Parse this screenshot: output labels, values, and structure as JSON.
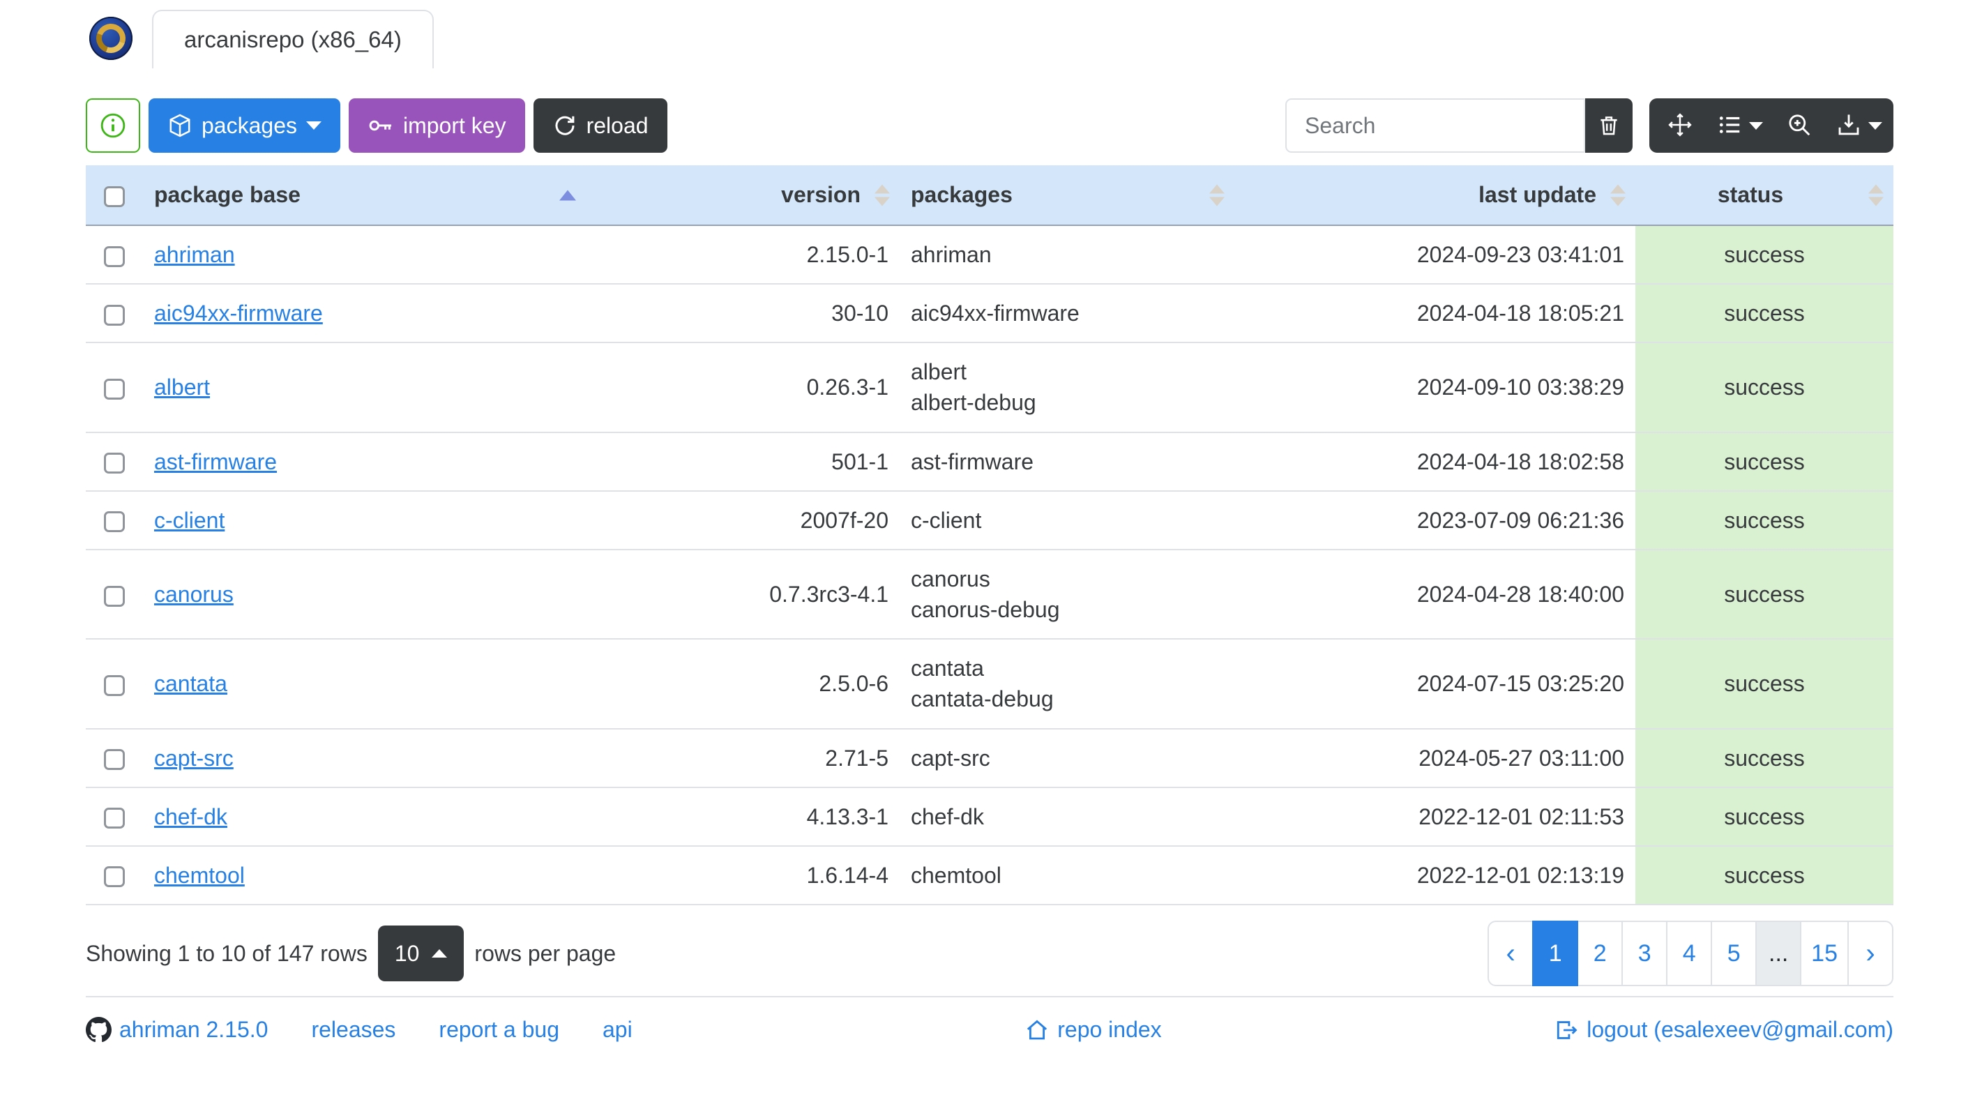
{
  "window": {
    "tab_title": "arcanisrepo (x86_64)"
  },
  "toolbar": {
    "info_button": "i",
    "packages_label": "packages",
    "import_key_label": "import key",
    "reload_label": "reload",
    "search_placeholder": "Search",
    "icon_buttons": [
      "trash-icon",
      "arrows-move-icon",
      "columns-list-icon",
      "zoom-in-icon",
      "export-download-icon"
    ]
  },
  "table": {
    "columns": {
      "package_base": "package base",
      "version": "version",
      "packages": "packages",
      "last_update": "last update",
      "status": "status"
    },
    "sort": {
      "column": "package base",
      "direction": "asc"
    },
    "rows": [
      {
        "package_base": "ahriman",
        "version": "2.15.0-1",
        "packages": [
          "ahriman"
        ],
        "last_update": "2024-09-23 03:41:01",
        "status": "success"
      },
      {
        "package_base": "aic94xx-firmware",
        "version": "30-10",
        "packages": [
          "aic94xx-firmware"
        ],
        "last_update": "2024-04-18 18:05:21",
        "status": "success"
      },
      {
        "package_base": "albert",
        "version": "0.26.3-1",
        "packages": [
          "albert",
          "albert-debug"
        ],
        "last_update": "2024-09-10 03:38:29",
        "status": "success"
      },
      {
        "package_base": "ast-firmware",
        "version": "501-1",
        "packages": [
          "ast-firmware"
        ],
        "last_update": "2024-04-18 18:02:58",
        "status": "success"
      },
      {
        "package_base": "c-client",
        "version": "2007f-20",
        "packages": [
          "c-client"
        ],
        "last_update": "2023-07-09 06:21:36",
        "status": "success"
      },
      {
        "package_base": "canorus",
        "version": "0.7.3rc3-4.1",
        "packages": [
          "canorus",
          "canorus-debug"
        ],
        "last_update": "2024-04-28 18:40:00",
        "status": "success"
      },
      {
        "package_base": "cantata",
        "version": "2.5.0-6",
        "packages": [
          "cantata",
          "cantata-debug"
        ],
        "last_update": "2024-07-15 03:25:20",
        "status": "success"
      },
      {
        "package_base": "capt-src",
        "version": "2.71-5",
        "packages": [
          "capt-src"
        ],
        "last_update": "2024-05-27 03:11:00",
        "status": "success"
      },
      {
        "package_base": "chef-dk",
        "version": "4.13.3-1",
        "packages": [
          "chef-dk"
        ],
        "last_update": "2022-12-01 02:11:53",
        "status": "success"
      },
      {
        "package_base": "chemtool",
        "version": "1.6.14-4",
        "packages": [
          "chemtool"
        ],
        "last_update": "2022-12-01 02:13:19",
        "status": "success"
      }
    ]
  },
  "pagination": {
    "summary": "Showing 1 to 10 of 147 rows",
    "page_size": "10",
    "page_size_suffix": "rows per page",
    "prev_label": "‹",
    "next_label": "›",
    "pages": [
      "1",
      "2",
      "3",
      "4",
      "5",
      "...",
      "15"
    ],
    "active_page": "1"
  },
  "footer": {
    "version_link": "ahriman 2.15.0",
    "releases_link": "releases",
    "report_bug_link": "report a bug",
    "api_link": "api",
    "repo_index_link": "repo index",
    "logout_link": "logout (esalexeev@gmail.com)"
  },
  "colors": {
    "primary": "#2780e3",
    "secondary": "#373a3c",
    "info_purple": "#9954bb",
    "success_green": "#3fb618",
    "table_header_bg": "#d4e6f9",
    "status_success_bg": "#d9f0d1",
    "sort_active_caret": "#7d8ee0"
  }
}
